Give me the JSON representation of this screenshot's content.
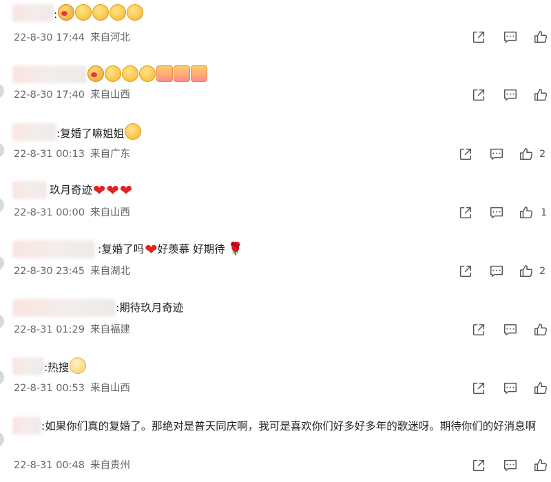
{
  "comments": [
    {
      "text": ":",
      "time": "22-8-30 17:44",
      "location": "来自河北",
      "likes": ""
    },
    {
      "text": "",
      "time": "22-8-30 17:40",
      "location": "来自山西",
      "likes": ""
    },
    {
      "text": ":复婚了嘛姐姐",
      "time": "22-8-31 00:13",
      "location": "来自广东",
      "likes": "2"
    },
    {
      "text": "玖月奇迹",
      "time": "22-8-31 00:00",
      "location": "来自山西",
      "likes": "1"
    },
    {
      "text": ":复婚了吗",
      "text2": "好羡慕 好期待",
      "time": "22-8-30 23:45",
      "location": "来自湖北",
      "likes": "2"
    },
    {
      "text": ":期待玖月奇迹",
      "time": "22-8-31 01:29",
      "location": "来自福建",
      "likes": ""
    },
    {
      "text": ":热搜",
      "time": "22-8-31 00:53",
      "location": "来自山西",
      "likes": ""
    },
    {
      "text": ":如果你们真的复婚了。那绝对是普天同庆啊，我可是喜欢你们好多好多年的歌迷呀。期待你们的好消息啊",
      "time": "22-8-31 00:48",
      "location": "来自贵州",
      "likes": ""
    }
  ],
  "icons": {
    "share": "share-icon",
    "reply": "comment-icon",
    "like": "thumbs-up-icon"
  },
  "colors": {
    "heart": "#e02424",
    "meta": "#666666"
  }
}
